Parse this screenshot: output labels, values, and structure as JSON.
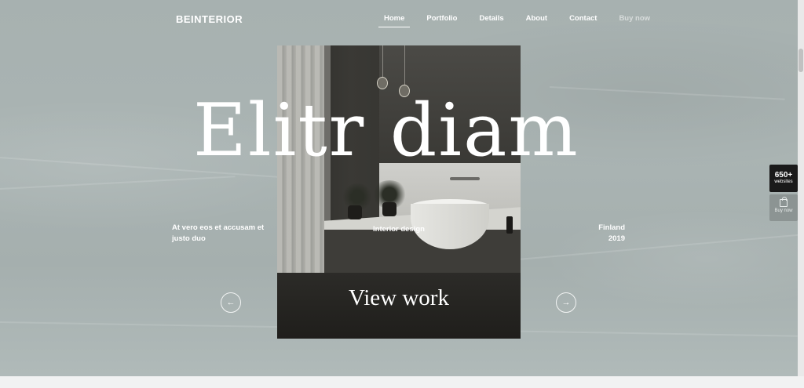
{
  "brand": {
    "logo_text": "BEINTERIOR"
  },
  "nav": {
    "items": [
      {
        "label": "Home",
        "active": true
      },
      {
        "label": "Portfolio",
        "active": false
      },
      {
        "label": "Details",
        "active": false
      },
      {
        "label": "About",
        "active": false
      },
      {
        "label": "Contact",
        "active": false
      },
      {
        "label": "Buy now",
        "active": false
      }
    ]
  },
  "hero": {
    "title": "Elitr diam",
    "cta_label": "View work",
    "caption_left": "At vero eos et accusam et justo duo",
    "caption_center": "Interior design",
    "caption_right_line1": "Finland",
    "caption_right_line2": "2019"
  },
  "slider": {
    "prev_icon": "arrow-left-icon",
    "next_icon": "arrow-right-icon",
    "prev_glyph": "←",
    "next_glyph": "→"
  },
  "side_panel": {
    "badge_number": "650+",
    "badge_sub": "websites",
    "buy_label": "Buy now",
    "buy_icon": "shopping-bag-icon"
  },
  "colors": {
    "background": "#a9b3b2",
    "text": "#ffffff",
    "badge_bg": "#1a1a1a"
  }
}
